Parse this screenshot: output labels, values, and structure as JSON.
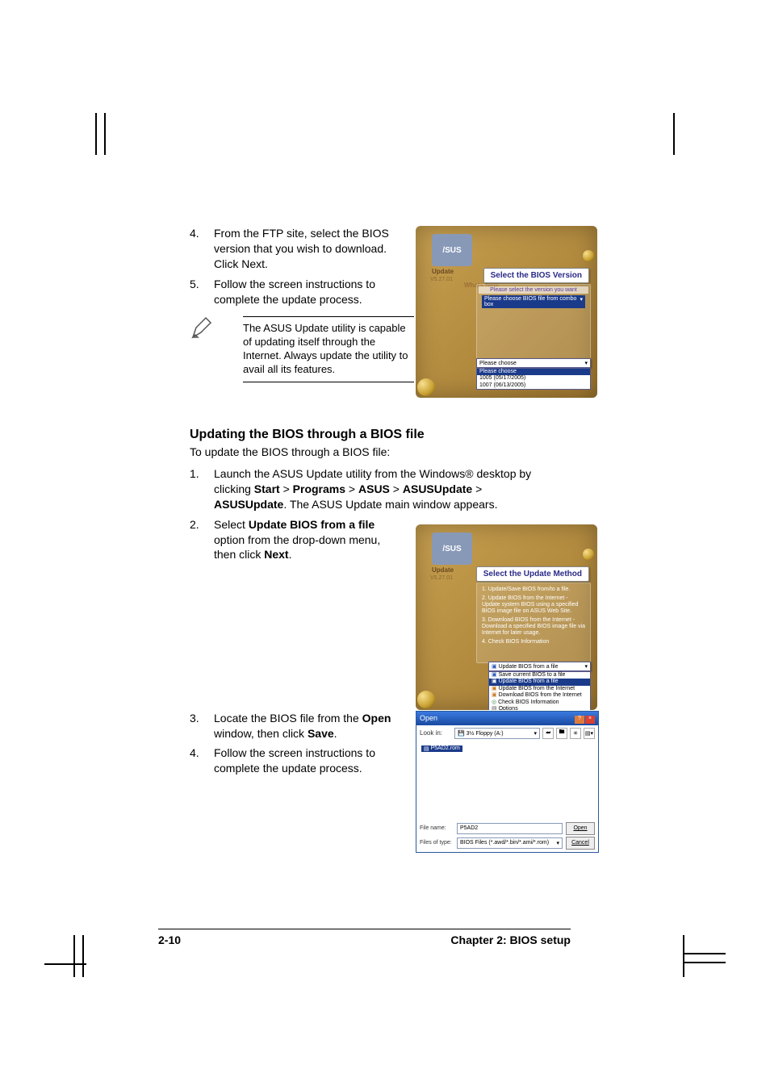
{
  "steps_ftp": [
    {
      "num": "4.",
      "text": "From the FTP site, select the BIOS version that you wish to download. Click Next."
    },
    {
      "num": "5.",
      "text": "Follow the screen instructions to complete the update process."
    }
  ],
  "note": "The ASUS Update utility is capable of updating itself through the Internet. Always update the utility to avail all its features.",
  "shot1": {
    "banner": "Select the BIOS Version",
    "instr": "Please select the version you want",
    "highlight": "Please choose BIOS file from combo box",
    "dd_label": "Please choose",
    "options": [
      "Please choose",
      "1005 (05/17/2005)",
      "1007 (06/13/2005)"
    ],
    "sidecut": "Whats\nNew"
  },
  "heading": "Updating the BIOS through a BIOS file",
  "subheading": "To update the BIOS through a BIOS file:",
  "steps_file": [
    {
      "num": "1.",
      "pre": "Launch the ASUS Update utility from the Windows® desktop by clicking ",
      "b1": "Start",
      "s1": " > ",
      "b2": "Programs",
      "s2": " > ",
      "b3": "ASUS",
      "s3": " > ",
      "b4": "ASUSUpdate",
      "s4": " > ",
      "b5": "ASUSUpdate",
      "post": ". The ASUS Update main window appears."
    },
    {
      "num": "2.",
      "pre": "Select ",
      "b1": "Update BIOS from a file",
      "mid": " option from the drop-down menu, then click ",
      "b2": "Next",
      "post": "."
    }
  ],
  "shot2": {
    "banner": "Select the Update Method",
    "opts": [
      "1. Update/Save BIOS from/to a file.",
      "2. Update BIOS from the Internet - Update system BIOS using a specified BIOS image file on ASUS Web Site.",
      "3. Download BIOS from the Internet - Download a specified BIOS image file via Internet for later usage.",
      "4. Check BIOS Information"
    ],
    "dd_sel": "Update BIOS from a file",
    "dd_items": [
      "Save current BIOS to a file",
      "Update BIOS from a file",
      "Update BIOS from the Internet",
      "Download BIOS from the Internet",
      "Check BIOS Information",
      "Options"
    ]
  },
  "steps_locate": [
    {
      "num": "3.",
      "pre": "Locate the BIOS file from the ",
      "b1": "Open",
      "mid": " window, then click ",
      "b2": "Save",
      "post": "."
    },
    {
      "num": "4.",
      "text": "Follow the screen instructions to complete the update process."
    }
  ],
  "filedlg": {
    "title": "Open",
    "lookin_lbl": "Look in:",
    "lookin_val": "3½ Floppy (A:)",
    "item": "P5AD2.rom",
    "filename_lbl": "File name:",
    "filename_val": "P5AD2",
    "filetype_lbl": "Files of type:",
    "filetype_val": "BIOS Files (*.awd/*.bin/*.ami/*.rom)",
    "open_btn": "Open",
    "cancel_btn": "Cancel"
  },
  "footer": {
    "page": "2-10",
    "chapter": "Chapter 2: BIOS setup"
  }
}
